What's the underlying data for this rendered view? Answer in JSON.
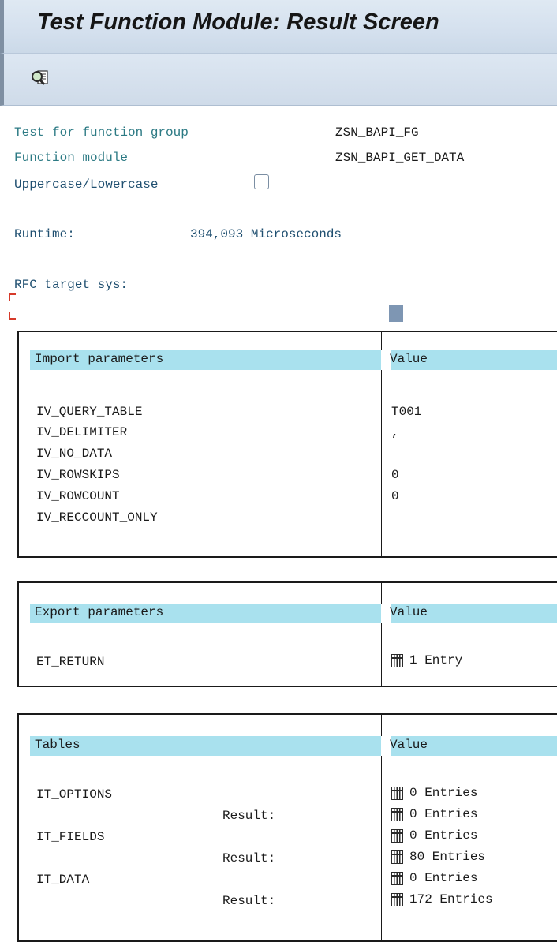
{
  "title": "Test Function Module: Result Screen",
  "toolbar": {
    "icon": "magnifier-document-icon"
  },
  "info": {
    "function_group_label": "Test for function group",
    "function_group_value": "ZSN_BAPI_FG",
    "function_module_label": "Function module",
    "function_module_value": "ZSN_BAPI_GET_DATA",
    "uppercase_label": "Uppercase/Lowercase",
    "runtime_label": "Runtime:",
    "runtime_value": "394,093 Microseconds",
    "rfc_label": "RFC target sys:"
  },
  "import": {
    "header": "Import parameters",
    "value_header": "Value",
    "rows": [
      {
        "name": "IV_QUERY_TABLE",
        "value": "T001"
      },
      {
        "name": "IV_DELIMITER",
        "value": ","
      },
      {
        "name": "IV_NO_DATA",
        "value": ""
      },
      {
        "name": "IV_ROWSKIPS",
        "value": "0"
      },
      {
        "name": "IV_ROWCOUNT",
        "value": "0"
      },
      {
        "name": "IV_RECCOUNT_ONLY",
        "value": ""
      }
    ]
  },
  "export": {
    "header": "Export parameters",
    "value_header": "Value",
    "rows": [
      {
        "name": "ET_RETURN",
        "value": "1 Entry"
      }
    ]
  },
  "tables": {
    "header": "Tables",
    "value_header": "Value",
    "result_label": "Result:",
    "rows": [
      {
        "name": "IT_OPTIONS",
        "value": "0 Entries",
        "result": "0 Entries"
      },
      {
        "name": "IT_FIELDS",
        "value": "0 Entries",
        "result": "80 Entries"
      },
      {
        "name": "IT_DATA",
        "value": "0 Entries",
        "result": "172 Entries"
      }
    ]
  }
}
